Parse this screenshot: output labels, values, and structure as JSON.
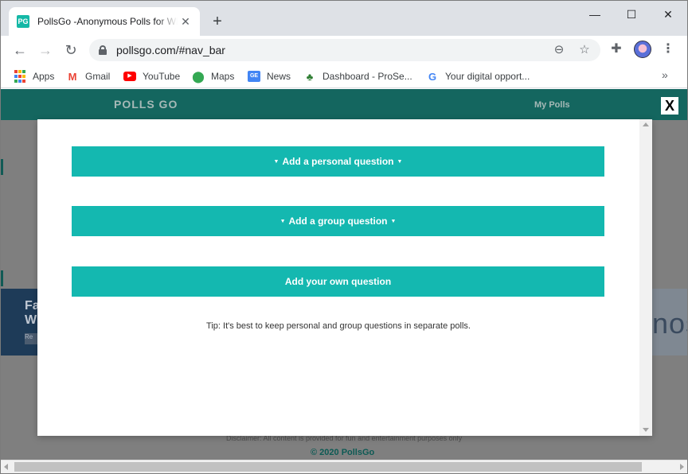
{
  "browser": {
    "tab_title": "PollsGo -Anonymous Polls for WhatsApp",
    "tab_favicon_text": "PG",
    "url": "pollsgo.com/#nav_bar",
    "bookmarks": [
      {
        "label": "Apps"
      },
      {
        "label": "Gmail"
      },
      {
        "label": "YouTube"
      },
      {
        "label": "Maps"
      },
      {
        "label": "News"
      },
      {
        "label": "Dashboard - ProSe..."
      },
      {
        "label": "Your digital opport..."
      }
    ]
  },
  "site": {
    "logo": "POLLS GO",
    "nav_my_polls": "My Polls",
    "footer_disclaimer": "Disclaimer: All content is provided for fun and entertainment purposes only",
    "footer_copyright": "© 2020 PollsGo",
    "bg_banner_line1": "Fa",
    "bg_banner_line2": "W",
    "bg_banner_btn": "Re",
    "bg_right_text": "nos"
  },
  "modal": {
    "close_label": "X",
    "personal_question": "Add a personal question",
    "group_question": "Add a group question",
    "own_question": "Add your own question",
    "tip": "Tip: It's best to keep personal and group questions in separate polls."
  },
  "colors": {
    "accent": "#14b8b0",
    "site_nav": "#14665f",
    "overlay": "#7f7f7f"
  }
}
